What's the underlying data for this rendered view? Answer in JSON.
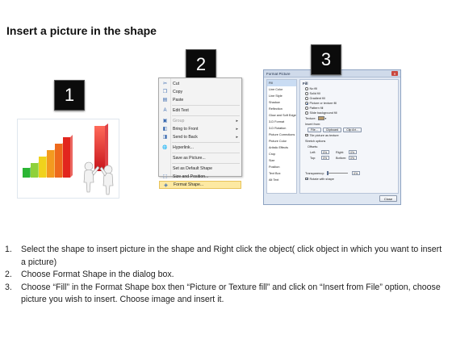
{
  "title": "Insert a picture in the shape",
  "badges": [
    "1",
    "2",
    "3"
  ],
  "context_menu": {
    "items": [
      {
        "label": "Cut",
        "icon": "scissors-icon",
        "glyph": "✂",
        "underline": "t"
      },
      {
        "label": "Copy",
        "icon": "copy-icon",
        "glyph": "❐"
      },
      {
        "label": "Paste",
        "icon": "paste-icon",
        "glyph": "▤"
      },
      {
        "label": "Edit Text",
        "icon": "text-icon",
        "glyph": "A"
      },
      {
        "label": "Group",
        "icon": "group-icon",
        "glyph": "▣",
        "submenu": true
      },
      {
        "label": "Bring to Front",
        "icon": "bring-front-icon",
        "glyph": "◧",
        "submenu": true
      },
      {
        "label": "Send to Back",
        "icon": "send-back-icon",
        "glyph": "◨",
        "submenu": true
      },
      {
        "label": "Hyperlink...",
        "icon": "hyperlink-icon",
        "glyph": "🌐"
      },
      {
        "label": "Save as Picture...",
        "icon": "",
        "glyph": ""
      },
      {
        "label": "Set as Default Shape",
        "icon": "",
        "glyph": ""
      },
      {
        "label": "Size and Position...",
        "icon": "size-icon",
        "glyph": "⬚"
      },
      {
        "label": "Format Shape...",
        "icon": "format-shape-icon",
        "glyph": "◈",
        "highlighted": true
      }
    ]
  },
  "dialog": {
    "title": "Format Picture",
    "close_glyph": "✕",
    "categories": [
      "Fill",
      "Line Color",
      "Line Style",
      "Shadow",
      "Reflection",
      "Glow and Soft Edges",
      "3-D Format",
      "3-D Rotation",
      "Picture Corrections",
      "Picture Color",
      "Artistic Effects",
      "Crop",
      "Size",
      "Position",
      "Text Box",
      "Alt Text"
    ],
    "fill_header": "Fill",
    "fill_options": [
      {
        "label": "No fill",
        "selected": false
      },
      {
        "label": "Solid fill",
        "selected": false
      },
      {
        "label": "Gradient fill",
        "selected": false
      },
      {
        "label": "Picture or texture fill",
        "selected": true
      },
      {
        "label": "Pattern fill",
        "selected": false
      },
      {
        "label": "Slide background fill",
        "selected": false
      }
    ],
    "texture_label": "Texture:",
    "insert_from_label": "Insert from:",
    "buttons": [
      "File...",
      "Clipboard",
      "Clip Art..."
    ],
    "tile_label": "Tile picture as texture",
    "stretch_label": "Stretch options",
    "offsets_label": "Offsets:",
    "offsets": [
      {
        "label": "Left:",
        "value": "0%"
      },
      {
        "label": "Right:",
        "value": "0%"
      },
      {
        "label": "Top:",
        "value": "0%"
      },
      {
        "label": "Bottom:",
        "value": "0%"
      }
    ],
    "transparency_label": "Transparency:",
    "transparency_value": "0%",
    "rotate_label": "Rotate with shape",
    "close_label": "Close"
  },
  "instructions": [
    {
      "num": "1.",
      "text": "Select the shape to insert picture in the shape and Right click the object( click object in which you want to insert a picture)"
    },
    {
      "num": "2.",
      "text": "Choose Format Shape in the dialog box."
    },
    {
      "num": "3.",
      "text": "Choose “Fill” in the Format Shape box then “Picture or Texture fill”  and click on “Insert from File” option, choose picture you wish to insert. Choose image and insert it."
    }
  ],
  "bar_colors": [
    "#2bb534",
    "#8fd13a",
    "#f0d21c",
    "#f39a1f",
    "#ee6a1c",
    "#e2261e",
    "#d7141a"
  ]
}
